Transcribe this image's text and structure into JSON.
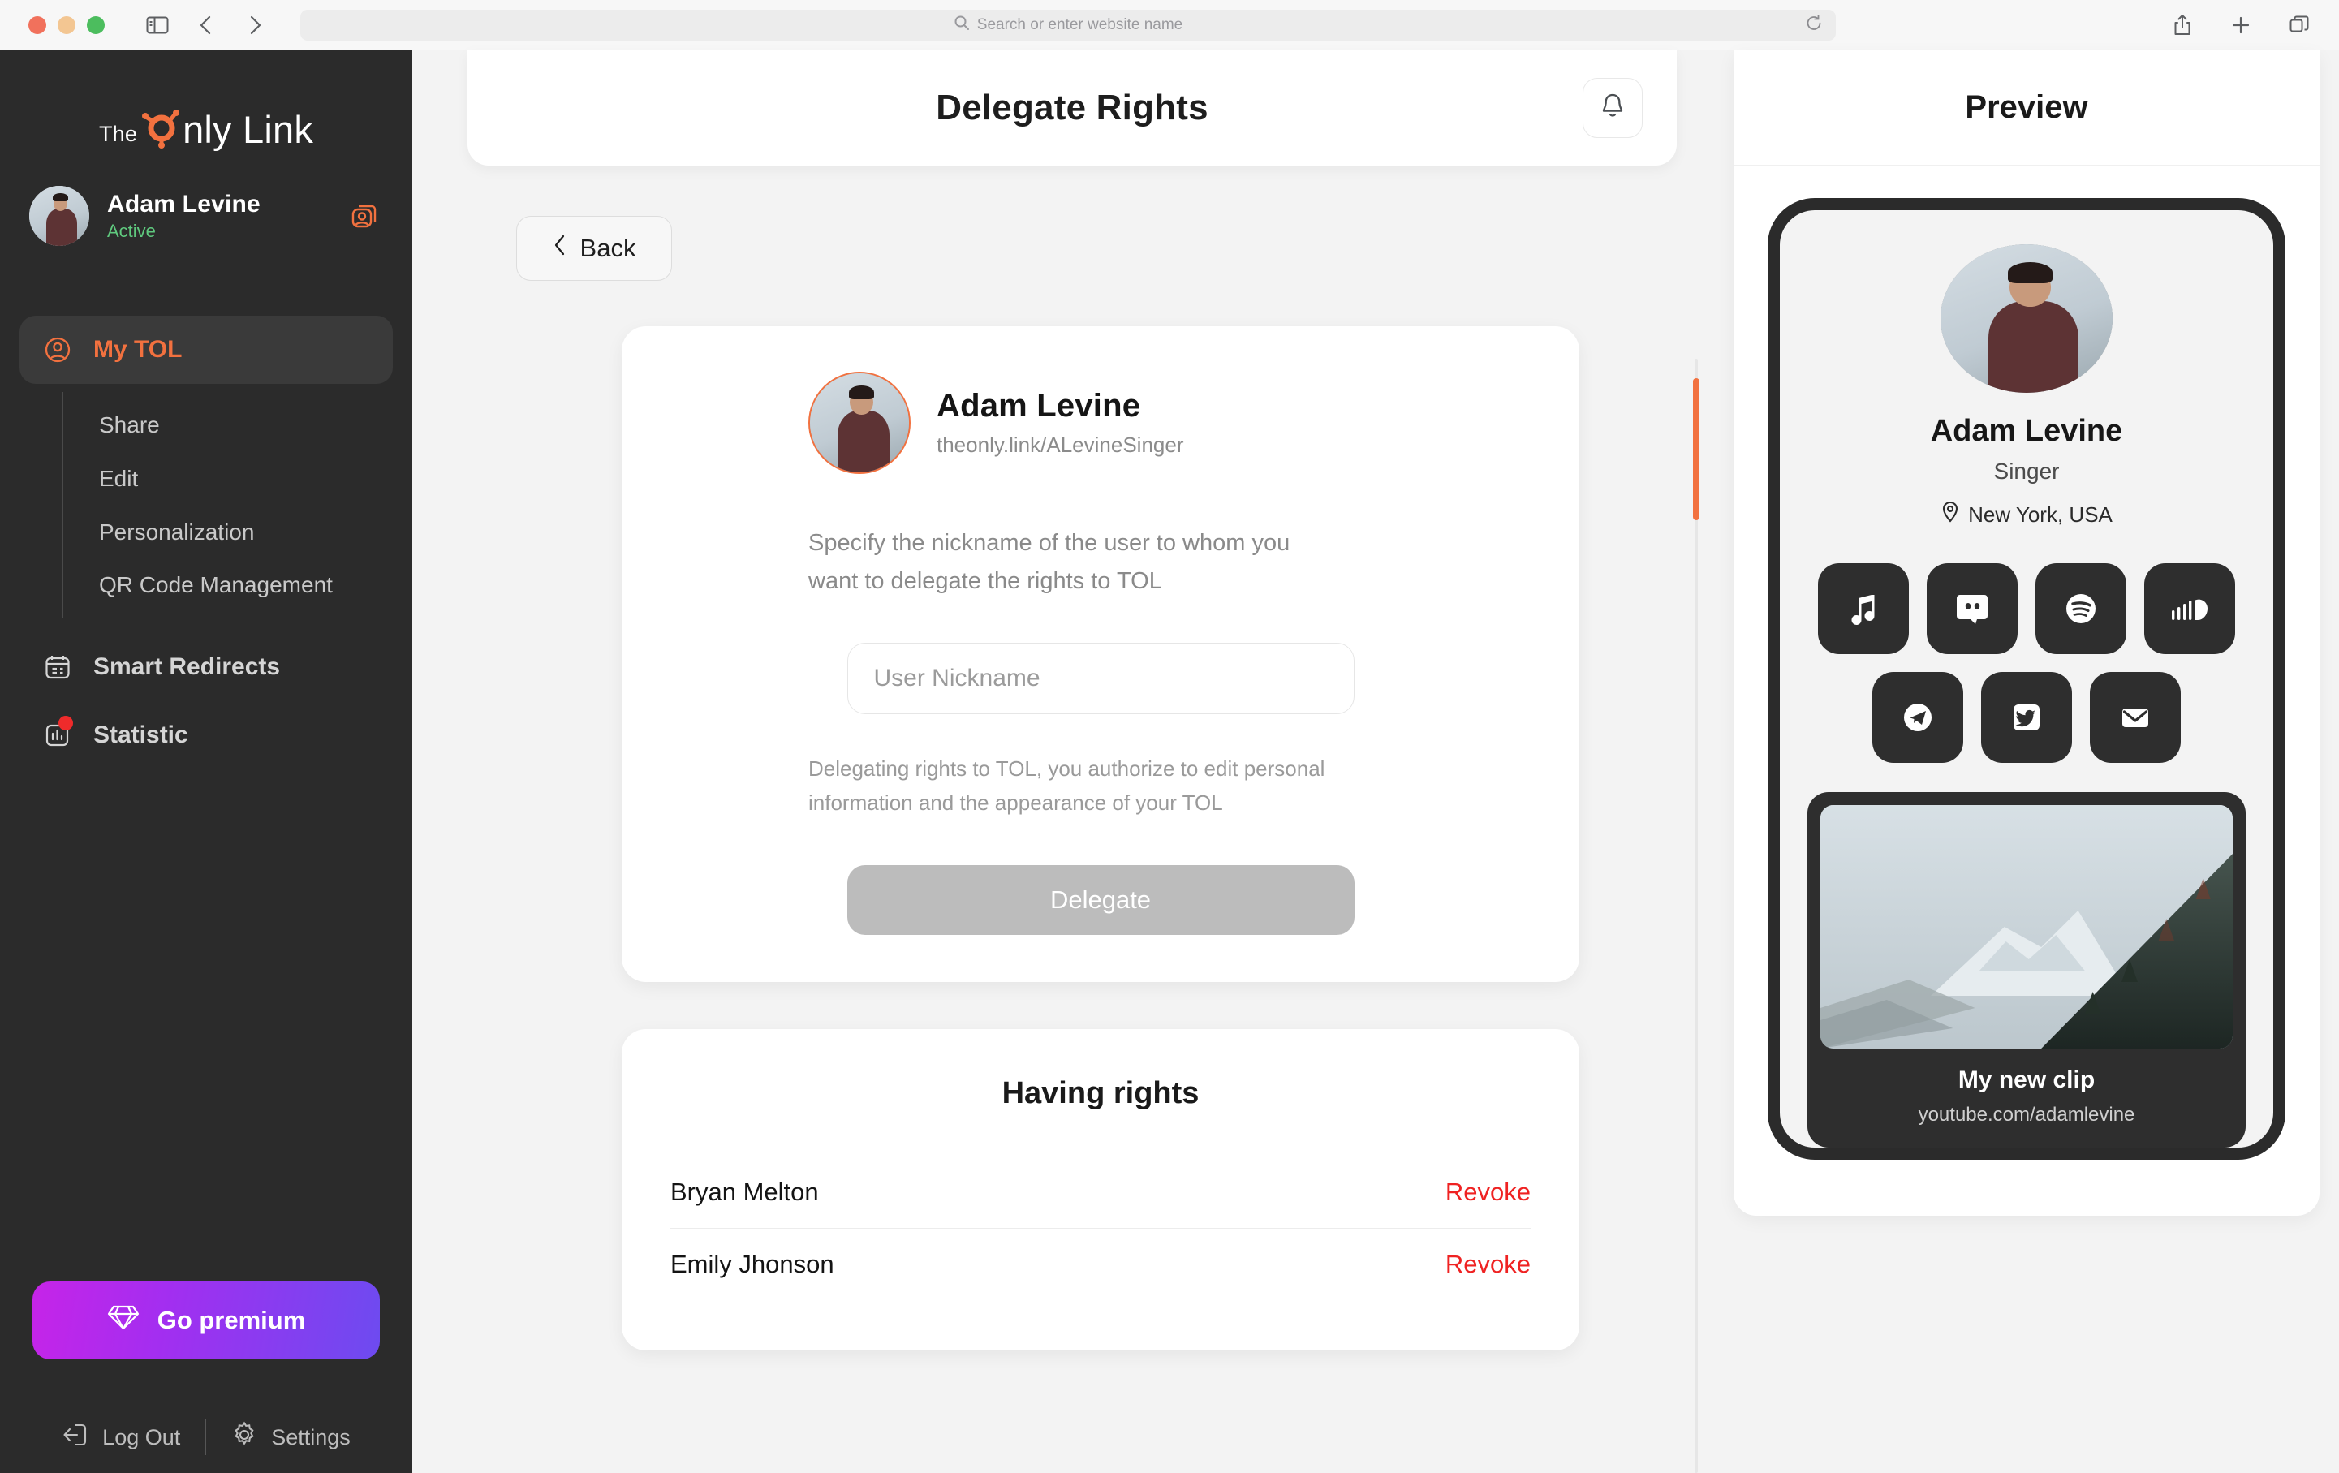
{
  "browser": {
    "address_placeholder": "Search or enter website name",
    "icons": {
      "sidebar_toggle": "sidebar-toggle-icon",
      "back": "nav-back-icon",
      "forward": "nav-forward-icon",
      "shield": "privacy-shield-icon",
      "search": "search-icon",
      "reload": "reload-icon",
      "share": "share-icon",
      "new_tab": "plus-icon",
      "tabs": "tabs-icon"
    }
  },
  "sidebar": {
    "logo": {
      "the": "The",
      "rest": "nly Link",
      "mark": "orange-o-mark"
    },
    "profile": {
      "name": "Adam Levine",
      "status": "Active",
      "switch_icon": "switch-profile-icon"
    },
    "nav": [
      {
        "label": "My TOL",
        "icon": "user-circle-icon",
        "active": true
      },
      {
        "label": "Smart Redirects",
        "icon": "calendar-icon",
        "active": false
      },
      {
        "label": "Statistic",
        "icon": "bar-chart-icon",
        "active": false,
        "badge": true
      }
    ],
    "subnav": [
      {
        "label": "Share"
      },
      {
        "label": "Edit"
      },
      {
        "label": "Personalization"
      },
      {
        "label": "QR Code Management"
      }
    ],
    "premium_label": "Go premium",
    "premium_icon": "diamond-icon",
    "logout_label": "Log Out",
    "logout_icon": "logout-icon",
    "settings_label": "Settings",
    "settings_icon": "gear-icon"
  },
  "main": {
    "header_title": "Delegate Rights",
    "bell_icon": "bell-icon",
    "back_label": "Back",
    "back_icon": "chevron-left-icon",
    "delegate_card": {
      "name": "Adam Levine",
      "url": "theonly.link/ALevineSinger",
      "description": "Specify the nickname of the user to whom you want to delegate the rights to TOL",
      "input_placeholder": "User Nickname",
      "input_value": "",
      "note": "Delegating rights to TOL, you authorize to edit personal information\nand the appearance of your TOL",
      "button_label": "Delegate"
    },
    "rights_card": {
      "title": "Having rights",
      "rows": [
        {
          "name": "Bryan Melton",
          "action": "Revoke"
        },
        {
          "name": "Emily Jhonson",
          "action": "Revoke"
        }
      ]
    }
  },
  "preview": {
    "title": "Preview",
    "profile": {
      "name": "Adam Levine",
      "role": "Singer",
      "location": "New York, USA",
      "location_icon": "map-pin-icon"
    },
    "links": [
      {
        "name": "apple-music-icon"
      },
      {
        "name": "discord-icon"
      },
      {
        "name": "spotify-icon"
      },
      {
        "name": "soundcloud-icon"
      },
      {
        "name": "telegram-icon"
      },
      {
        "name": "twitter-icon"
      },
      {
        "name": "email-icon"
      }
    ],
    "clip": {
      "title": "My new clip",
      "url": "youtube.com/adamlevine"
    }
  },
  "colors": {
    "accent": "#f2713f",
    "sidebar_bg": "#2b2b2b",
    "page_bg": "#f3f3f3",
    "danger": "#ef2222",
    "success": "#5fc97e",
    "premium_from": "#c624e8",
    "premium_to": "#6d4bf0"
  }
}
